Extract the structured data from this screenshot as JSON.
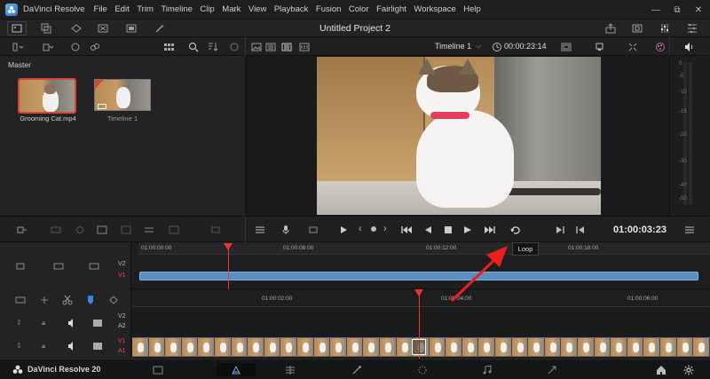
{
  "menu": {
    "app_name": "DaVinci Resolve",
    "items": [
      "File",
      "Edit",
      "Trim",
      "Timeline",
      "Clip",
      "Mark",
      "View",
      "Playback",
      "Fusion",
      "Color",
      "Fairlight",
      "Workspace",
      "Help"
    ]
  },
  "window_controls": {
    "minimize": "—",
    "maximize": "⧉",
    "close": "✕"
  },
  "project": {
    "title": "Untitled Project 2"
  },
  "viewer_header": {
    "timeline_name": "Timeline 1",
    "duration": "00:00:23:14"
  },
  "media_pool": {
    "bin_name": "Master",
    "items": [
      {
        "label": "Grooming Cat.mp4",
        "selected": true
      },
      {
        "label": "Timeline 1",
        "selected": false
      }
    ]
  },
  "audio_meter_labels": [
    "0",
    "-5",
    "-10",
    "-15",
    "-20",
    "-30",
    "-40",
    "-50"
  ],
  "transport": {
    "timecode": "01:00:03:23"
  },
  "upper_timeline": {
    "ruler_ticks": [
      "01:00:00:00",
      "01:00:06:00",
      "01:00:12:00",
      "01:00:18:00"
    ],
    "tracks": [
      "V2",
      "V1"
    ]
  },
  "lower_timeline": {
    "ruler_ticks": [
      "01:00:02:00",
      "01:00:04:00",
      "01:00:06:00"
    ],
    "tracks": [
      "V2",
      "A2",
      "V1",
      "A1"
    ]
  },
  "tooltip": {
    "text": "Loop"
  },
  "footer": {
    "brand": "DaVinci Resolve 20"
  },
  "colors": {
    "playhead": "#e33333",
    "clip_blue": "#5a8fc0",
    "annotation_arrow": "#e8201e",
    "collar": "#e83d5a"
  }
}
